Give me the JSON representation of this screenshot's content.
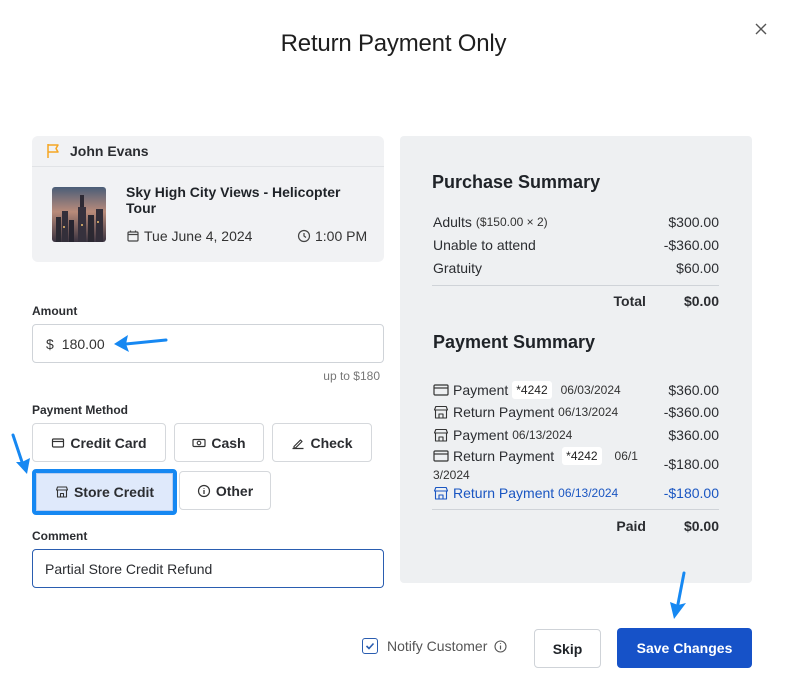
{
  "modal": {
    "title": "Return Payment Only",
    "close_icon": "close-icon"
  },
  "booking": {
    "customer_name": "John Evans",
    "flag_color": "#f5a623",
    "tour_title": "Sky High City Views - Helicopter Tour",
    "date": "Tue June 4, 2024",
    "time": "1:00 PM"
  },
  "amount": {
    "label": "Amount",
    "currency": "$",
    "value": "180.00",
    "hint": "up to $180"
  },
  "payment_method": {
    "label": "Payment Method",
    "options": [
      {
        "label": "Credit Card",
        "icon": "credit-card-icon"
      },
      {
        "label": "Cash",
        "icon": "cash-icon"
      },
      {
        "label": "Check",
        "icon": "check-icon"
      },
      {
        "label": "Store Credit",
        "icon": "store-icon",
        "selected": true
      },
      {
        "label": "Other",
        "icon": "info-icon"
      }
    ]
  },
  "comment": {
    "label": "Comment",
    "value": "Partial Store Credit Refund"
  },
  "purchase_summary": {
    "heading": "Purchase Summary",
    "rows": [
      {
        "label": "Adults",
        "detail": "($150.00 × 2)",
        "value": "$300.00"
      },
      {
        "label": "Unable to attend",
        "value": "-$360.00"
      },
      {
        "label": "Gratuity",
        "value": "$60.00"
      }
    ],
    "total_label": "Total",
    "total_value": "$0.00"
  },
  "payment_summary": {
    "heading": "Payment Summary",
    "rows": [
      {
        "label": "Payment",
        "card": "*4242",
        "date": "06/03/2024",
        "value": "$360.00",
        "icon": "credit-card-icon"
      },
      {
        "label": "Return Payment",
        "date": "06/13/2024",
        "value": "-$360.00",
        "icon": "store-icon"
      },
      {
        "label": "Payment",
        "date": "06/13/2024",
        "value": "$360.00",
        "icon": "store-icon"
      },
      {
        "label": "Return Payment",
        "card": "*4242",
        "date_part1": "06/1",
        "date_part2": "3/2024",
        "value": "-$180.00",
        "icon": "credit-card-icon"
      },
      {
        "label": "Return Payment",
        "date": "06/13/2024",
        "value": "-$180.00",
        "icon": "store-icon",
        "color": "#1a56c2"
      }
    ],
    "paid_label": "Paid",
    "paid_value": "$0.00"
  },
  "footer": {
    "notify_label": "Notify Customer",
    "notify_checked": true,
    "skip_label": "Skip",
    "save_label": "Save Changes"
  },
  "colors": {
    "primary": "#1652c8",
    "annotation_arrow": "#1688f2",
    "panel_bg": "#eef0f2"
  }
}
